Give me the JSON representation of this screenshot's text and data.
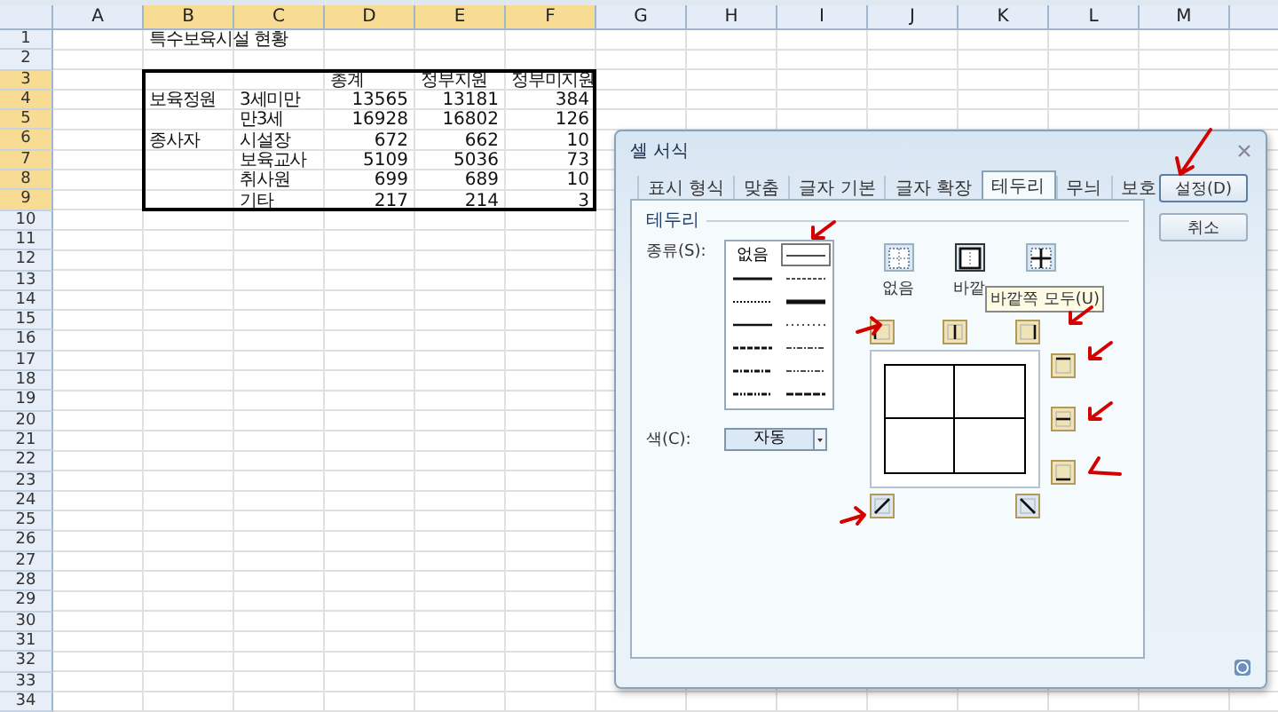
{
  "sheet": {
    "columns": [
      {
        "label": "A",
        "selected": false
      },
      {
        "label": "B",
        "selected": true
      },
      {
        "label": "C",
        "selected": true
      },
      {
        "label": "D",
        "selected": true
      },
      {
        "label": "E",
        "selected": true
      },
      {
        "label": "F",
        "selected": true
      },
      {
        "label": "G",
        "selected": false
      },
      {
        "label": "H",
        "selected": false
      },
      {
        "label": "I",
        "selected": false
      },
      {
        "label": "J",
        "selected": false
      },
      {
        "label": "K",
        "selected": false
      },
      {
        "label": "L",
        "selected": false
      },
      {
        "label": "M",
        "selected": false
      }
    ],
    "rows": [
      {
        "header": "1",
        "selected": false,
        "cells": [
          null,
          {
            "text": "특수보육시설 현황",
            "kind": "text"
          }
        ]
      },
      {
        "header": "2",
        "selected": false
      },
      {
        "header": "3",
        "selected": true,
        "cells": [
          null,
          null,
          null,
          {
            "text": "총계",
            "kind": "text"
          },
          {
            "text": "정부지원",
            "kind": "text"
          },
          {
            "text": "정부미지원",
            "kind": "text"
          }
        ]
      },
      {
        "header": "4",
        "selected": true,
        "cells": [
          null,
          {
            "text": "보육정원",
            "kind": "text"
          },
          {
            "text": "3세미만",
            "kind": "text"
          },
          {
            "text": "13565",
            "kind": "number"
          },
          {
            "text": "13181",
            "kind": "number"
          },
          {
            "text": "384",
            "kind": "number"
          }
        ]
      },
      {
        "header": "5",
        "selected": true,
        "cells": [
          null,
          null,
          {
            "text": "만3세",
            "kind": "text"
          },
          {
            "text": "16928",
            "kind": "number"
          },
          {
            "text": "16802",
            "kind": "number"
          },
          {
            "text": "126",
            "kind": "number"
          }
        ]
      },
      {
        "header": "6",
        "selected": true,
        "cells": [
          null,
          {
            "text": "종사자",
            "kind": "text"
          },
          {
            "text": "시설장",
            "kind": "text"
          },
          {
            "text": "672",
            "kind": "number"
          },
          {
            "text": "662",
            "kind": "number"
          },
          {
            "text": "10",
            "kind": "number"
          }
        ]
      },
      {
        "header": "7",
        "selected": true,
        "cells": [
          null,
          null,
          {
            "text": "보육교사",
            "kind": "text"
          },
          {
            "text": "5109",
            "kind": "number"
          },
          {
            "text": "5036",
            "kind": "number"
          },
          {
            "text": "73",
            "kind": "number"
          }
        ]
      },
      {
        "header": "8",
        "selected": true,
        "cells": [
          null,
          null,
          {
            "text": "취사원",
            "kind": "text"
          },
          {
            "text": "699",
            "kind": "number"
          },
          {
            "text": "689",
            "kind": "number"
          },
          {
            "text": "10",
            "kind": "number"
          }
        ]
      },
      {
        "header": "9",
        "selected": true,
        "cells": [
          null,
          null,
          {
            "text": "기타",
            "kind": "text"
          },
          {
            "text": "217",
            "kind": "number"
          },
          {
            "text": "214",
            "kind": "number"
          },
          {
            "text": "3",
            "kind": "number"
          }
        ]
      },
      {
        "header": "10",
        "selected": false
      },
      {
        "header": "11",
        "selected": false
      },
      {
        "header": "12",
        "selected": false
      },
      {
        "header": "13",
        "selected": false
      },
      {
        "header": "14",
        "selected": false
      },
      {
        "header": "15",
        "selected": false
      },
      {
        "header": "16",
        "selected": false
      },
      {
        "header": "17",
        "selected": false
      },
      {
        "header": "18",
        "selected": false
      },
      {
        "header": "19",
        "selected": false
      },
      {
        "header": "20",
        "selected": false
      },
      {
        "header": "21",
        "selected": false
      },
      {
        "header": "22",
        "selected": false
      },
      {
        "header": "23",
        "selected": false
      },
      {
        "header": "24",
        "selected": false
      },
      {
        "header": "25",
        "selected": false
      },
      {
        "header": "26",
        "selected": false
      },
      {
        "header": "27",
        "selected": false
      },
      {
        "header": "28",
        "selected": false
      },
      {
        "header": "29",
        "selected": false
      },
      {
        "header": "30",
        "selected": false
      },
      {
        "header": "31",
        "selected": false
      },
      {
        "header": "32",
        "selected": false
      },
      {
        "header": "33",
        "selected": false
      },
      {
        "header": "34",
        "selected": false
      }
    ]
  },
  "dialog": {
    "title": "셀 서식",
    "tabs": [
      {
        "label": "표시 형식",
        "selected": false
      },
      {
        "label": "맞춤",
        "selected": false
      },
      {
        "label": "글자 기본",
        "selected": false
      },
      {
        "label": "글자 확장",
        "selected": false
      },
      {
        "label": "테두리",
        "selected": true
      },
      {
        "label": "무늬",
        "selected": false
      },
      {
        "label": "보호",
        "selected": false
      }
    ],
    "buttons": [
      "설정(D)",
      "취소"
    ],
    "group_title": "테두리",
    "style_label": "종류(S):",
    "line_styles": [
      {
        "kind": "none",
        "label": "없음",
        "selected": false
      },
      {
        "kind": "hair",
        "selected": true
      },
      {
        "kind": "medium",
        "selected": false
      },
      {
        "kind": "dashed",
        "selected": false
      },
      {
        "kind": "dotted",
        "selected": false
      },
      {
        "kind": "thick",
        "selected": false
      },
      {
        "kind": "thin",
        "selected": false
      },
      {
        "kind": "hairdot",
        "selected": false
      },
      {
        "kind": "mdash",
        "selected": false
      },
      {
        "kind": "dashdot",
        "selected": false
      },
      {
        "kind": "mdashdot",
        "selected": false
      },
      {
        "kind": "dashdotdot",
        "selected": false
      },
      {
        "kind": "mdashdotdot",
        "selected": false
      },
      {
        "kind": "slant",
        "selected": false
      }
    ],
    "color_label": "색(C):",
    "color_value": "자동",
    "presets": [
      {
        "kind": "none",
        "label": "없음",
        "selected": false
      },
      {
        "kind": "outline",
        "label": "바깥",
        "selected": true
      },
      {
        "kind": "inside",
        "selected": false
      }
    ],
    "tooltip": "바깥쪽 모두(U)",
    "border_buttons": [
      {
        "kind": "left"
      },
      {
        "kind": "vertical"
      },
      {
        "kind": "right"
      },
      {
        "kind": "top"
      },
      {
        "kind": "horizontal"
      },
      {
        "kind": "bottom"
      },
      {
        "kind": "diag_up"
      },
      {
        "kind": "diag_down"
      }
    ],
    "preview": {
      "outline": true,
      "inner": true
    }
  }
}
